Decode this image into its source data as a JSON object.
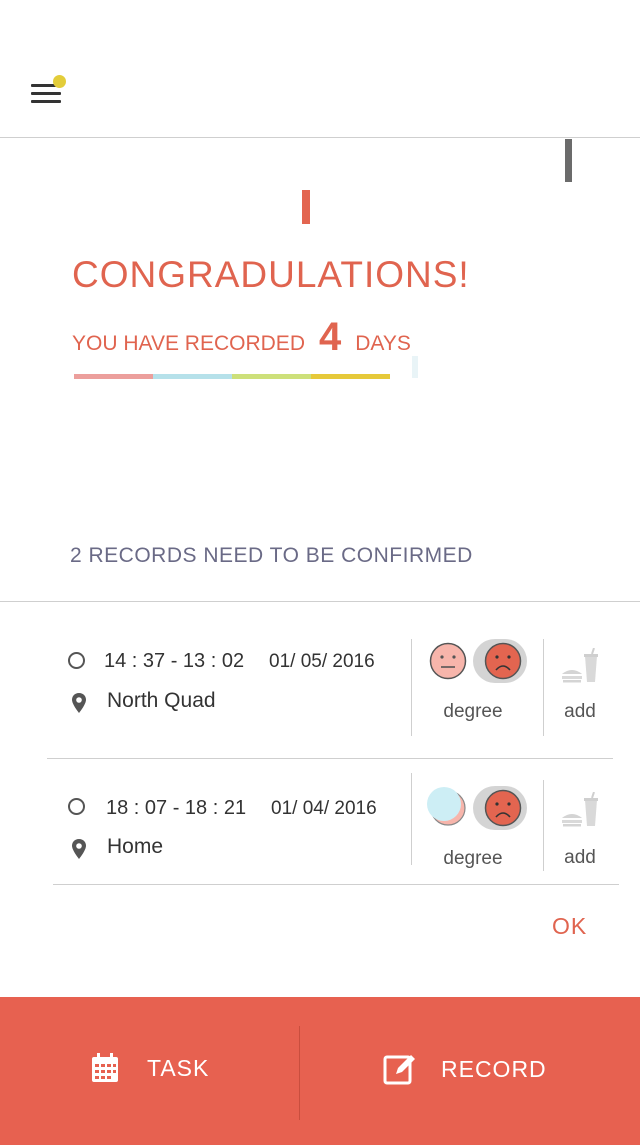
{
  "header": {
    "menu_icon": "hamburger-menu-icon",
    "notification_color": "#e3cd3a"
  },
  "hero": {
    "title": "CONGRADULATIONS!",
    "subtitle_prefix": "YOU HAVE RECORDED",
    "days_count": "4",
    "subtitle_suffix": "DAYS",
    "progress_colors": [
      "#ec9f9c",
      "#b6e1ea",
      "#cde07a",
      "#e6c93a"
    ]
  },
  "records_section": {
    "title": "2 RECORDS NEED TO BE CONFIRMED",
    "records": [
      {
        "time": "14 : 37 - 13 : 02",
        "date": "01/ 05/ 2016",
        "location": "North Quad",
        "degree_label": "degree",
        "add_label": "add"
      },
      {
        "time": "18 : 07 - 18 : 21",
        "date": "01/ 04/ 2016",
        "location": "Home",
        "degree_label": "degree",
        "add_label": "add"
      }
    ],
    "ok_label": "OK"
  },
  "bottom_nav": {
    "task_label": "TASK",
    "record_label": "RECORD",
    "task_icon": "calendar-icon",
    "record_icon": "edit-icon"
  },
  "colors": {
    "accent": "#e0644f",
    "bar": "#e76150"
  }
}
